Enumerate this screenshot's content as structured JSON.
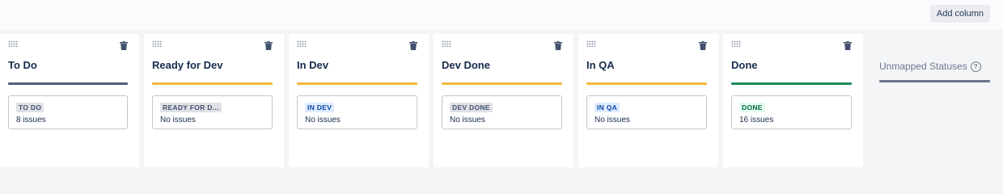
{
  "toolbar": {
    "add_column_label": "Add column"
  },
  "columns": [
    {
      "title": "To Do",
      "status": "TO DO",
      "count": "8 issues",
      "line_color": "#505f79",
      "lozenge_bg": "#dfe1e6",
      "lozenge_fg": "#42526e"
    },
    {
      "title": "Ready for Dev",
      "status": "READY FOR D...",
      "count": "No issues",
      "line_color": "#f6b73c",
      "lozenge_bg": "#dfe1e6",
      "lozenge_fg": "#42526e"
    },
    {
      "title": "In Dev",
      "status": "IN DEV",
      "count": "No issues",
      "line_color": "#f6b73c",
      "lozenge_bg": "#deebff",
      "lozenge_fg": "#0747a6"
    },
    {
      "title": "Dev Done",
      "status": "DEV DONE",
      "count": "No issues",
      "line_color": "#f6b73c",
      "lozenge_bg": "#dfe1e6",
      "lozenge_fg": "#42526e"
    },
    {
      "title": "In QA",
      "status": "IN QA",
      "count": "No issues",
      "line_color": "#f6b73c",
      "lozenge_bg": "#deebff",
      "lozenge_fg": "#0747a6"
    },
    {
      "title": "Done",
      "status": "DONE",
      "count": "16 issues",
      "line_color": "#1b8a5a",
      "lozenge_bg": "#e3fcef",
      "lozenge_fg": "#006644"
    }
  ],
  "unmapped": {
    "title": "Unmapped Statuses",
    "help_icon": "question-circle-icon"
  },
  "icons": {
    "drag": "drag-handle-icon",
    "delete": "trash-icon"
  }
}
